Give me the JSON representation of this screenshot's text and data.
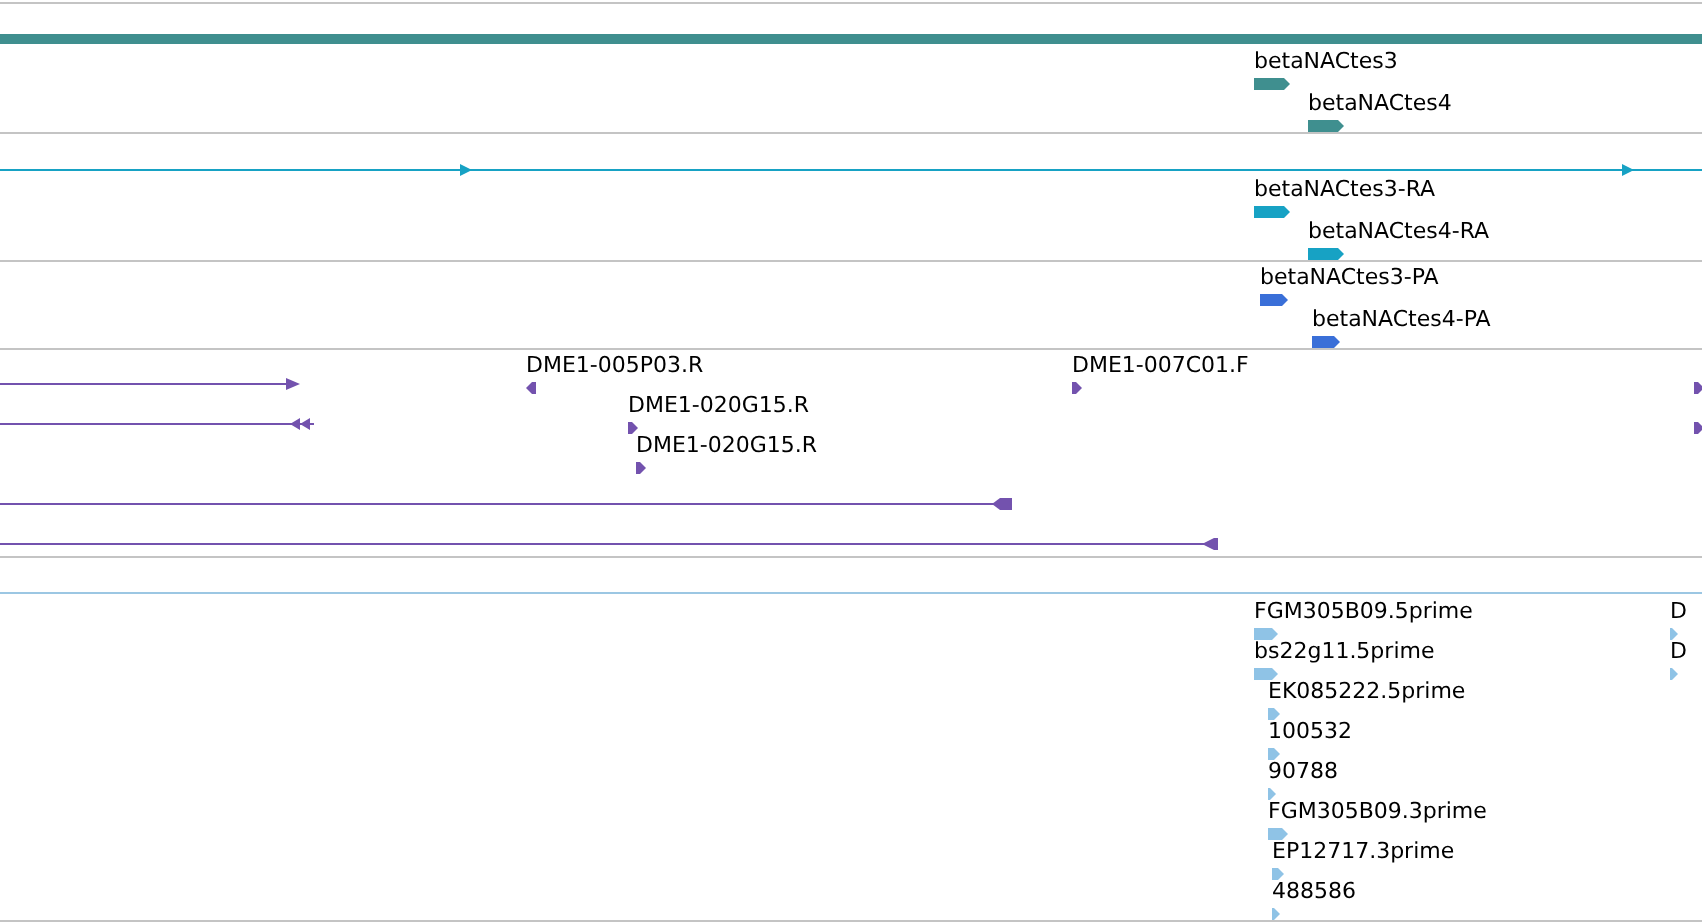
{
  "tracks": [
    {
      "color": "#3f8f8f",
      "features": [
        {
          "label": "betaNACtes3",
          "reverse": false
        },
        {
          "label": "betaNACtes4",
          "reverse": false
        }
      ]
    },
    {
      "color": "#17a2c4",
      "features": [
        {
          "label": "betaNACtes3-RA",
          "reverse": false
        },
        {
          "label": "betaNACtes4-RA",
          "reverse": false
        }
      ]
    },
    {
      "color": "#3a6fd8",
      "features": [
        {
          "label": "betaNACtes3-PA",
          "reverse": false
        },
        {
          "label": "betaNACtes4-PA",
          "reverse": false
        }
      ]
    },
    {
      "color": "#7352ae",
      "features": [
        {
          "label": "DME1-005P03.R",
          "reverse": true
        },
        {
          "label": "DME1-020G15.R",
          "reverse": false
        },
        {
          "label": "DME1-020G15.R",
          "reverse": false
        },
        {
          "label": "DME1-007C01.F",
          "reverse": false
        },
        {
          "reverse": false
        },
        {
          "reverse": false
        }
      ]
    },
    {
      "color": "#8fc3e6",
      "features": [
        {
          "label": "FGM305B09.5prime",
          "reverse": false
        },
        {
          "label": "bs22g11.5prime",
          "reverse": false
        },
        {
          "label": "EK085222.5prime",
          "reverse": false
        },
        {
          "label": "100532",
          "reverse": false
        },
        {
          "label": "90788",
          "reverse": false
        },
        {
          "label": "FGM305B09.3prime",
          "reverse": false
        },
        {
          "label": "EP12717.3prime",
          "reverse": false
        },
        {
          "label": "488586",
          "reverse": false
        },
        {
          "label": "D",
          "reverse": false
        },
        {
          "label": "D",
          "reverse": false
        }
      ]
    }
  ]
}
